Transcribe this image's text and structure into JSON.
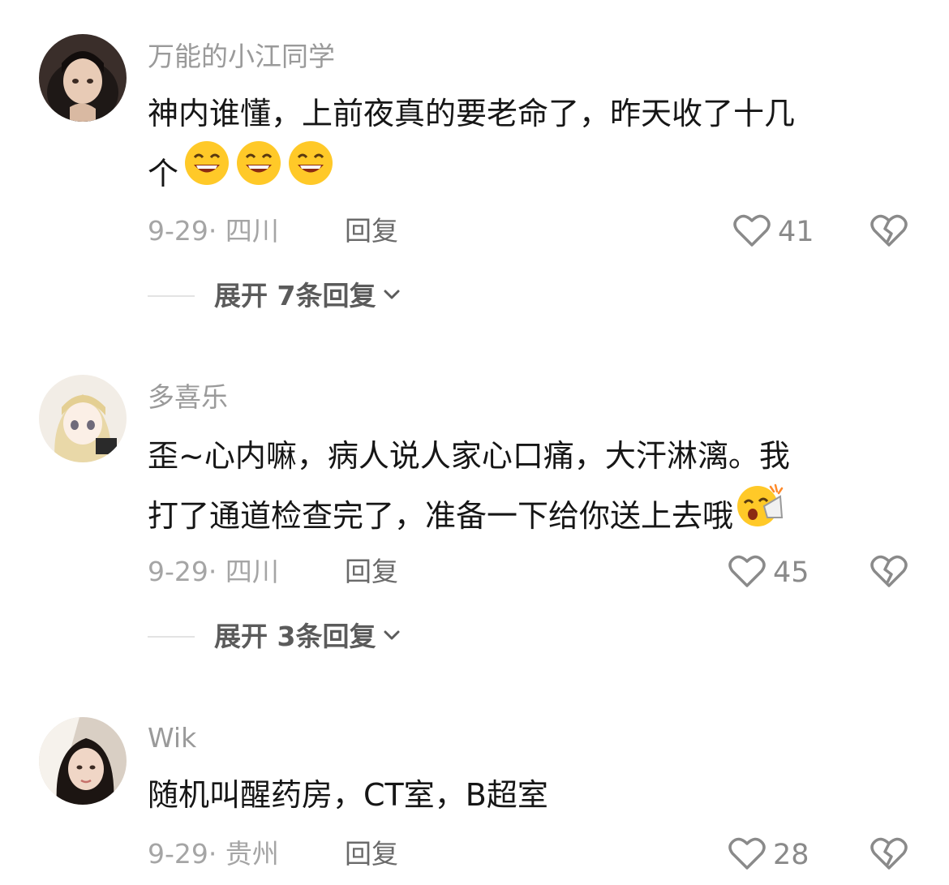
{
  "comments": [
    {
      "username": "万能的小江同学",
      "lines": [
        "神内谁懂，上前夜真的要老命了，昨天收了十几",
        "个"
      ],
      "emoji": "grinning-sweat-emoji",
      "date_location": "9-29· 四川",
      "reply_label": "回复",
      "likes": "41",
      "expand_label": "展开 7条回复"
    },
    {
      "username": "多喜乐",
      "lines": [
        "歪~心内嘛，病人说人家心口痛，大汗淋漓。我",
        "打了通道检查完了，准备一下给你送上去哦"
      ],
      "emoji": "cheering-emoji",
      "date_location": "9-29· 四川",
      "reply_label": "回复",
      "likes": "45",
      "expand_label": "展开 3条回复"
    },
    {
      "username": "Wik",
      "lines": [
        "随机叫醒药房，CT室，B超室"
      ],
      "date_location": "9-29· 贵州",
      "reply_label": "回复",
      "likes": "28"
    }
  ],
  "icons": {
    "like": "heart-outline-icon",
    "dislike": "broken-heart-icon",
    "expand": "chevron-down-icon"
  },
  "colors": {
    "username": "#9a9a9a",
    "text": "#161616",
    "meta": "#a5a5a5",
    "emoji": "#ffc928"
  }
}
